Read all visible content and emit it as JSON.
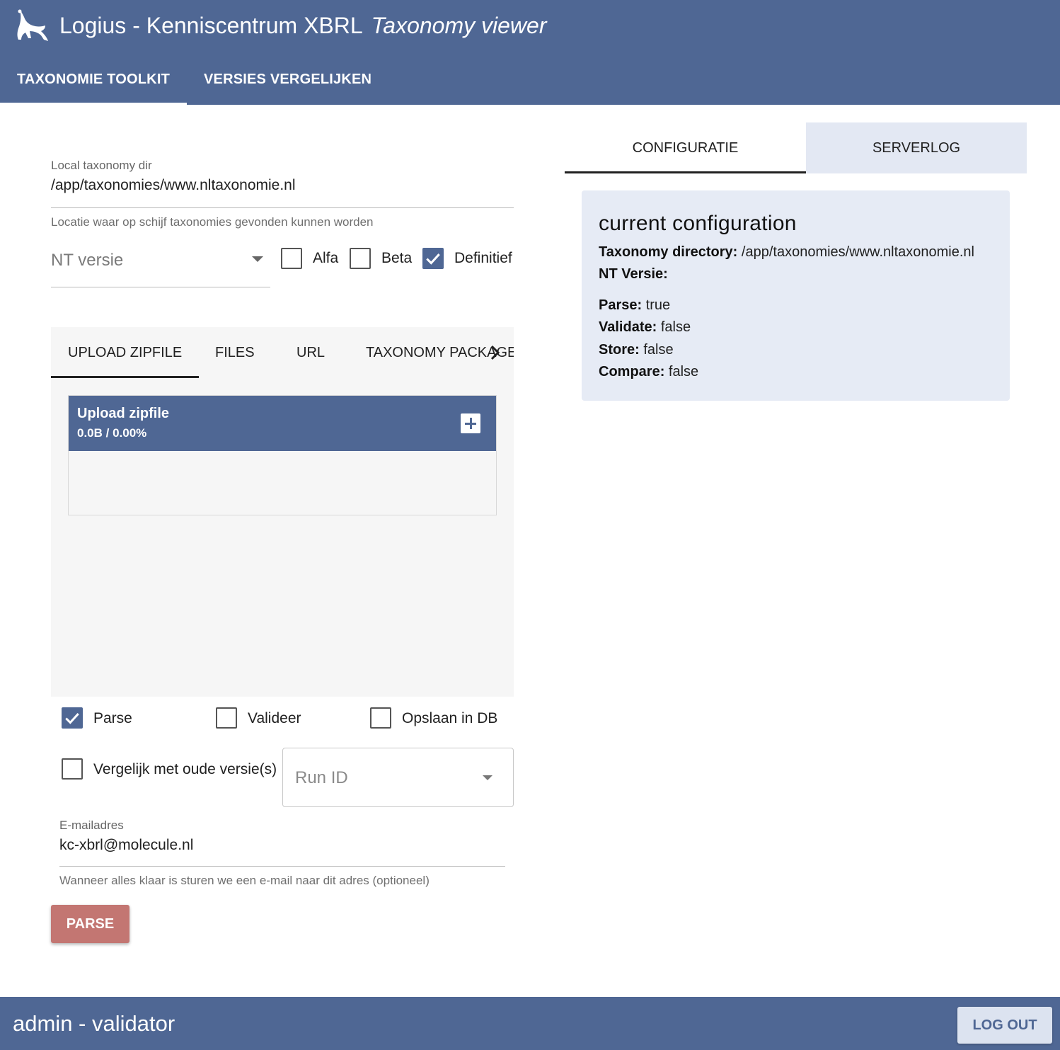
{
  "header": {
    "app_title": "Logius - Kenniscentrum XBRL",
    "app_subtitle": "Taxonomy viewer",
    "logo_icon": "lizard-logo-icon",
    "tabs": [
      {
        "label": "TAXONOMIE TOOLKIT",
        "active": true
      },
      {
        "label": "VERSIES VERGELIJKEN",
        "active": false
      }
    ]
  },
  "form": {
    "taxonomy_dir": {
      "label": "Local taxonomy dir",
      "value": "/app/taxonomies/www.nltaxonomie.nl",
      "hint": "Locatie waar op schijf taxonomies gevonden kunnen worden"
    },
    "nt_versie": {
      "placeholder": "NT versie"
    },
    "stages": [
      {
        "label": "Alfa",
        "checked": false
      },
      {
        "label": "Beta",
        "checked": false
      },
      {
        "label": "Definitief",
        "checked": true
      }
    ],
    "source_tabs": [
      {
        "label": "UPLOAD ZIPFILE",
        "active": true
      },
      {
        "label": "FILES",
        "active": false
      },
      {
        "label": "URL",
        "active": false
      },
      {
        "label": "TAXONOMY PACKAGE",
        "active": false
      }
    ],
    "upload": {
      "title": "Upload zipfile",
      "stats": "0.0B / 0.00%"
    },
    "actions": [
      {
        "label": "Parse",
        "checked": true
      },
      {
        "label": "Valideer",
        "checked": false
      },
      {
        "label": "Opslaan in DB",
        "checked": false
      }
    ],
    "compare": {
      "label": "Vergelijk met oude versie(s)",
      "checked": false
    },
    "run_id": {
      "placeholder": "Run ID"
    },
    "email": {
      "label": "E-mailadres",
      "value": "kc-xbrl@molecule.nl",
      "hint": "Wanneer alles klaar is sturen we een e-mail naar dit adres (optioneel)"
    },
    "submit_label": "PARSE"
  },
  "right_panel": {
    "tabs": [
      {
        "label": "CONFIGURATIE",
        "active": true
      },
      {
        "label": "SERVERLOG",
        "active": false
      }
    ],
    "config": {
      "title": "current configuration",
      "rows": [
        {
          "key": "Taxonomy directory:",
          "value": "/app/taxonomies/www.nltaxonomie.nl"
        },
        {
          "key": "NT Versie:",
          "value": ""
        },
        {
          "key": "Parse:",
          "value": "true"
        },
        {
          "key": "Validate:",
          "value": "false"
        },
        {
          "key": "Store:",
          "value": "false"
        },
        {
          "key": "Compare:",
          "value": "false"
        }
      ]
    }
  },
  "footer": {
    "user": "admin - validator",
    "logout_label": "LOG OUT"
  },
  "colors": {
    "primary": "#4f6794",
    "accent_button": "#c37672",
    "panel_bg": "#e6ebf5"
  }
}
